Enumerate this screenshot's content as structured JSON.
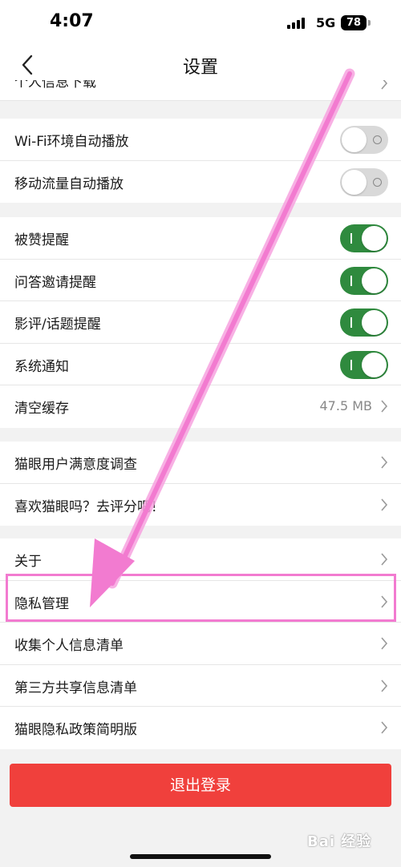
{
  "status_bar": {
    "time": "4:07",
    "network": "5G",
    "battery": "78"
  },
  "nav": {
    "title": "设置"
  },
  "partial_row": {
    "label": "个人信息下载"
  },
  "autoplay_group": [
    {
      "label": "Wi-Fi环境自动播放",
      "toggle": "off"
    },
    {
      "label": "移动流量自动播放",
      "toggle": "off"
    }
  ],
  "notify_group": [
    {
      "label": "被赞提醒",
      "toggle": "on"
    },
    {
      "label": "问答邀请提醒",
      "toggle": "on"
    },
    {
      "label": "影评/话题提醒",
      "toggle": "on"
    },
    {
      "label": "系统通知",
      "toggle": "on"
    },
    {
      "label": "清空缓存",
      "value": "47.5 MB"
    }
  ],
  "feedback_group": [
    {
      "label": "猫眼用户满意度调查"
    },
    {
      "label": "喜欢猫眼吗？去评分吧！"
    }
  ],
  "about_group": [
    {
      "label": "关于"
    },
    {
      "label": "隐私管理"
    },
    {
      "label": "收集个人信息清单"
    },
    {
      "label": "第三方共享信息清单"
    },
    {
      "label": "猫眼隐私政策简明版"
    }
  ],
  "logout": {
    "label": "退出登录"
  },
  "watermark": {
    "text": "Bai 经验"
  },
  "colors": {
    "toggle_on": "#2f8a3e",
    "toggle_off": "#d9d9d9",
    "logout": "#f0403c",
    "annotation": "#f27bd0"
  }
}
